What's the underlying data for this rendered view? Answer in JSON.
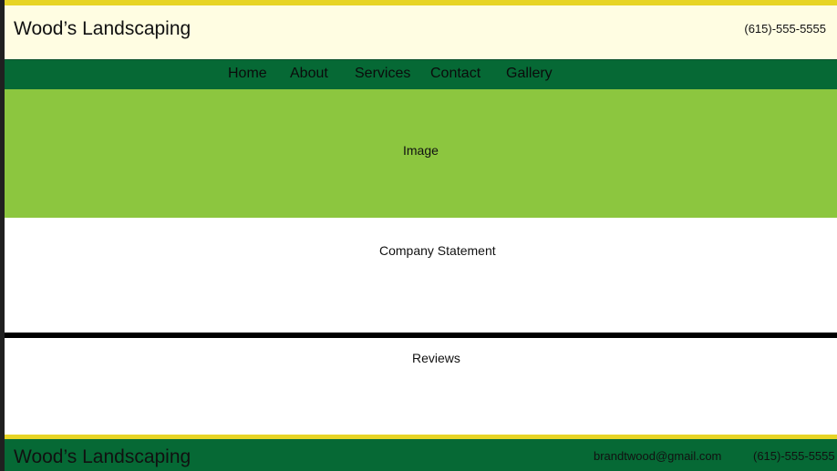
{
  "header": {
    "brand": "Wood’s Landscaping",
    "phone": "(615)-555-5555"
  },
  "nav": {
    "items": [
      {
        "label": "Home"
      },
      {
        "label": "About"
      },
      {
        "label": "Services"
      },
      {
        "label": "Contact"
      },
      {
        "label": "Gallery"
      }
    ]
  },
  "hero": {
    "label": "Image"
  },
  "statement": {
    "label": "Company Statement"
  },
  "reviews": {
    "label": "Reviews"
  },
  "footer": {
    "brand": "Wood’s Landscaping",
    "email": "brandtwood@gmail.com",
    "phone": "(615)-555-5555"
  },
  "colors": {
    "accent_yellow": "#e7d425",
    "header_bg": "#fffde2",
    "brand_green": "#066935",
    "hero_green": "#8cc63f"
  }
}
